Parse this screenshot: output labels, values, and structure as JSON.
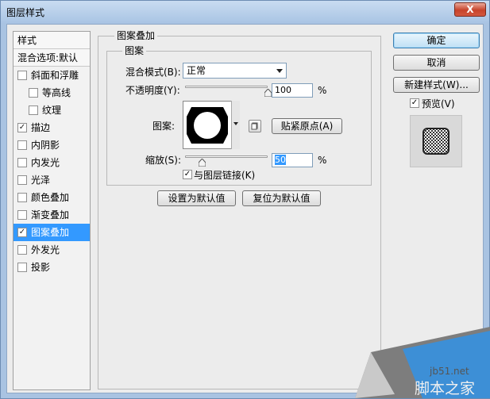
{
  "window": {
    "title": "图层样式",
    "close_label": "X"
  },
  "left_list": {
    "header_styles": "样式",
    "header_blending": "混合选项:默认",
    "items": [
      {
        "label": "斜面和浮雕",
        "checked": false,
        "indent": false
      },
      {
        "label": "等高线",
        "checked": false,
        "indent": true
      },
      {
        "label": "纹理",
        "checked": false,
        "indent": true
      },
      {
        "label": "描边",
        "checked": true,
        "indent": false
      },
      {
        "label": "内阴影",
        "checked": false,
        "indent": false
      },
      {
        "label": "内发光",
        "checked": false,
        "indent": false
      },
      {
        "label": "光泽",
        "checked": false,
        "indent": false
      },
      {
        "label": "颜色叠加",
        "checked": false,
        "indent": false
      },
      {
        "label": "渐变叠加",
        "checked": false,
        "indent": false
      },
      {
        "label": "图案叠加",
        "checked": true,
        "indent": false,
        "selected": true
      },
      {
        "label": "外发光",
        "checked": false,
        "indent": false
      },
      {
        "label": "投影",
        "checked": false,
        "indent": false
      }
    ],
    "check_mark": "✓"
  },
  "panel": {
    "group_title": "图案叠加",
    "subgroup_title": "图案",
    "blend_mode_label": "混合模式(B):",
    "blend_mode_value": "正常",
    "opacity_label": "不透明度(Y):",
    "opacity_value": "100",
    "opacity_fraction": 1.0,
    "percent": "%",
    "pattern_label": "图案:",
    "snap_origin_button": "贴紧原点(A)",
    "scale_label": "缩放(S):",
    "scale_value": "50",
    "scale_fraction": 0.2,
    "link_layer_label": "与图层链接(K)",
    "link_layer_checked": true,
    "set_default_button": "设置为默认值",
    "reset_default_button": "复位为默认值"
  },
  "right": {
    "ok_button": "确定",
    "cancel_button": "取消",
    "new_style_button": "新建样式(W)...",
    "preview_label": "预览(V)",
    "preview_checked": true
  },
  "watermark": {
    "url": "jb51.net",
    "name": "脚本之家"
  }
}
